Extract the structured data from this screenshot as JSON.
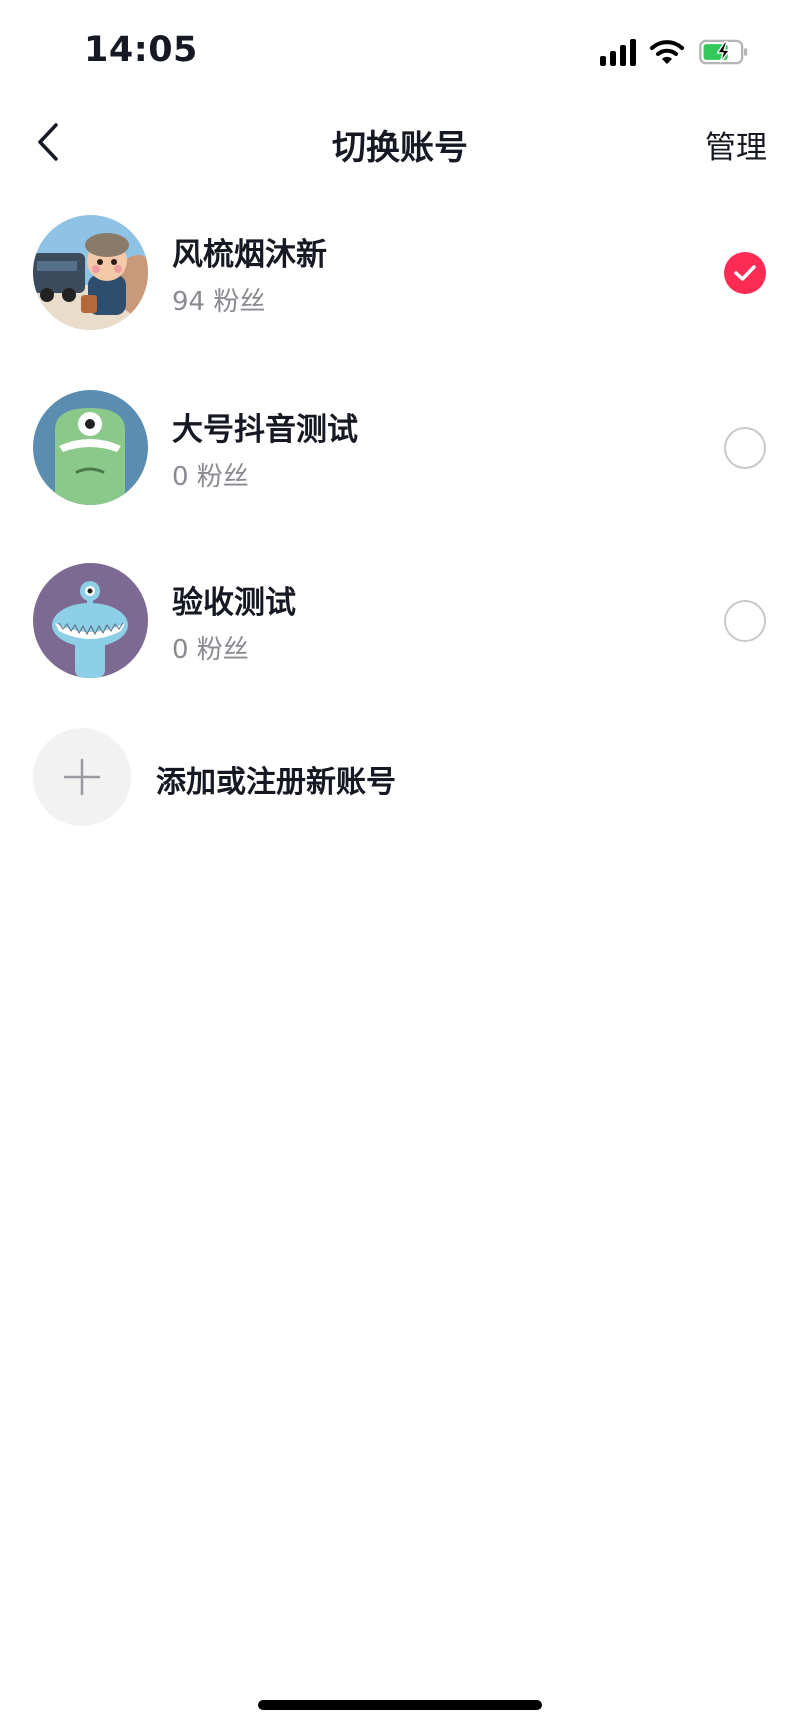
{
  "status_bar": {
    "time": "14:05",
    "icons": [
      "cellular-signal-icon",
      "wifi-icon",
      "battery-charging-icon"
    ]
  },
  "nav": {
    "back_icon": "chevron-left-icon",
    "title": "切换账号",
    "manage_label": "管理"
  },
  "accounts": [
    {
      "name": "风梳烟沐新",
      "followers": "94 粉丝",
      "selected": true
    },
    {
      "name": "大号抖音测试",
      "followers": "0 粉丝",
      "selected": false
    },
    {
      "name": "验收测试",
      "followers": "0 粉丝",
      "selected": false
    }
  ],
  "add_account": {
    "icon": "plus-icon",
    "label": "添加或注册新账号"
  },
  "colors": {
    "accent": "#fe2c55",
    "text_primary": "#161823",
    "text_secondary": "#8a8b91",
    "battery_green": "#34c759"
  }
}
